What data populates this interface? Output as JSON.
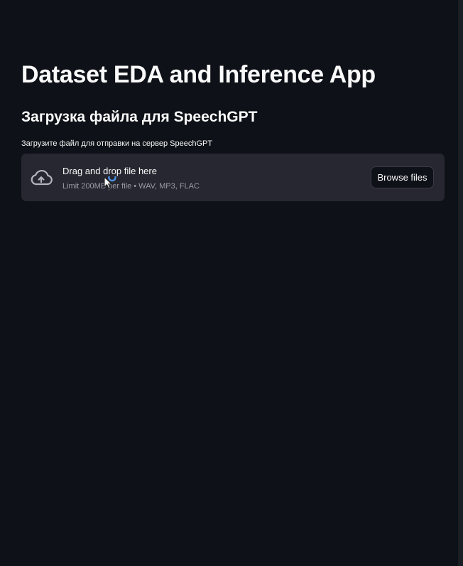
{
  "app": {
    "title": "Dataset EDA and Inference App",
    "subheader": "Загрузка файла для SpeechGPT"
  },
  "uploader": {
    "label": "Загрузите файл для отправки на сервер SpeechGPT",
    "drop_text": "Drag and drop file here",
    "limit_text": "Limit 200MB per file • WAV, MP3, FLAC",
    "browse_label": "Browse files",
    "icon": "cloud-upload-icon"
  },
  "colors": {
    "background": "#0e1117",
    "dropzone": "#262730",
    "text": "#fafafa",
    "muted_text": "#9a9ca5",
    "cursor_ring": "#4a90e2"
  }
}
